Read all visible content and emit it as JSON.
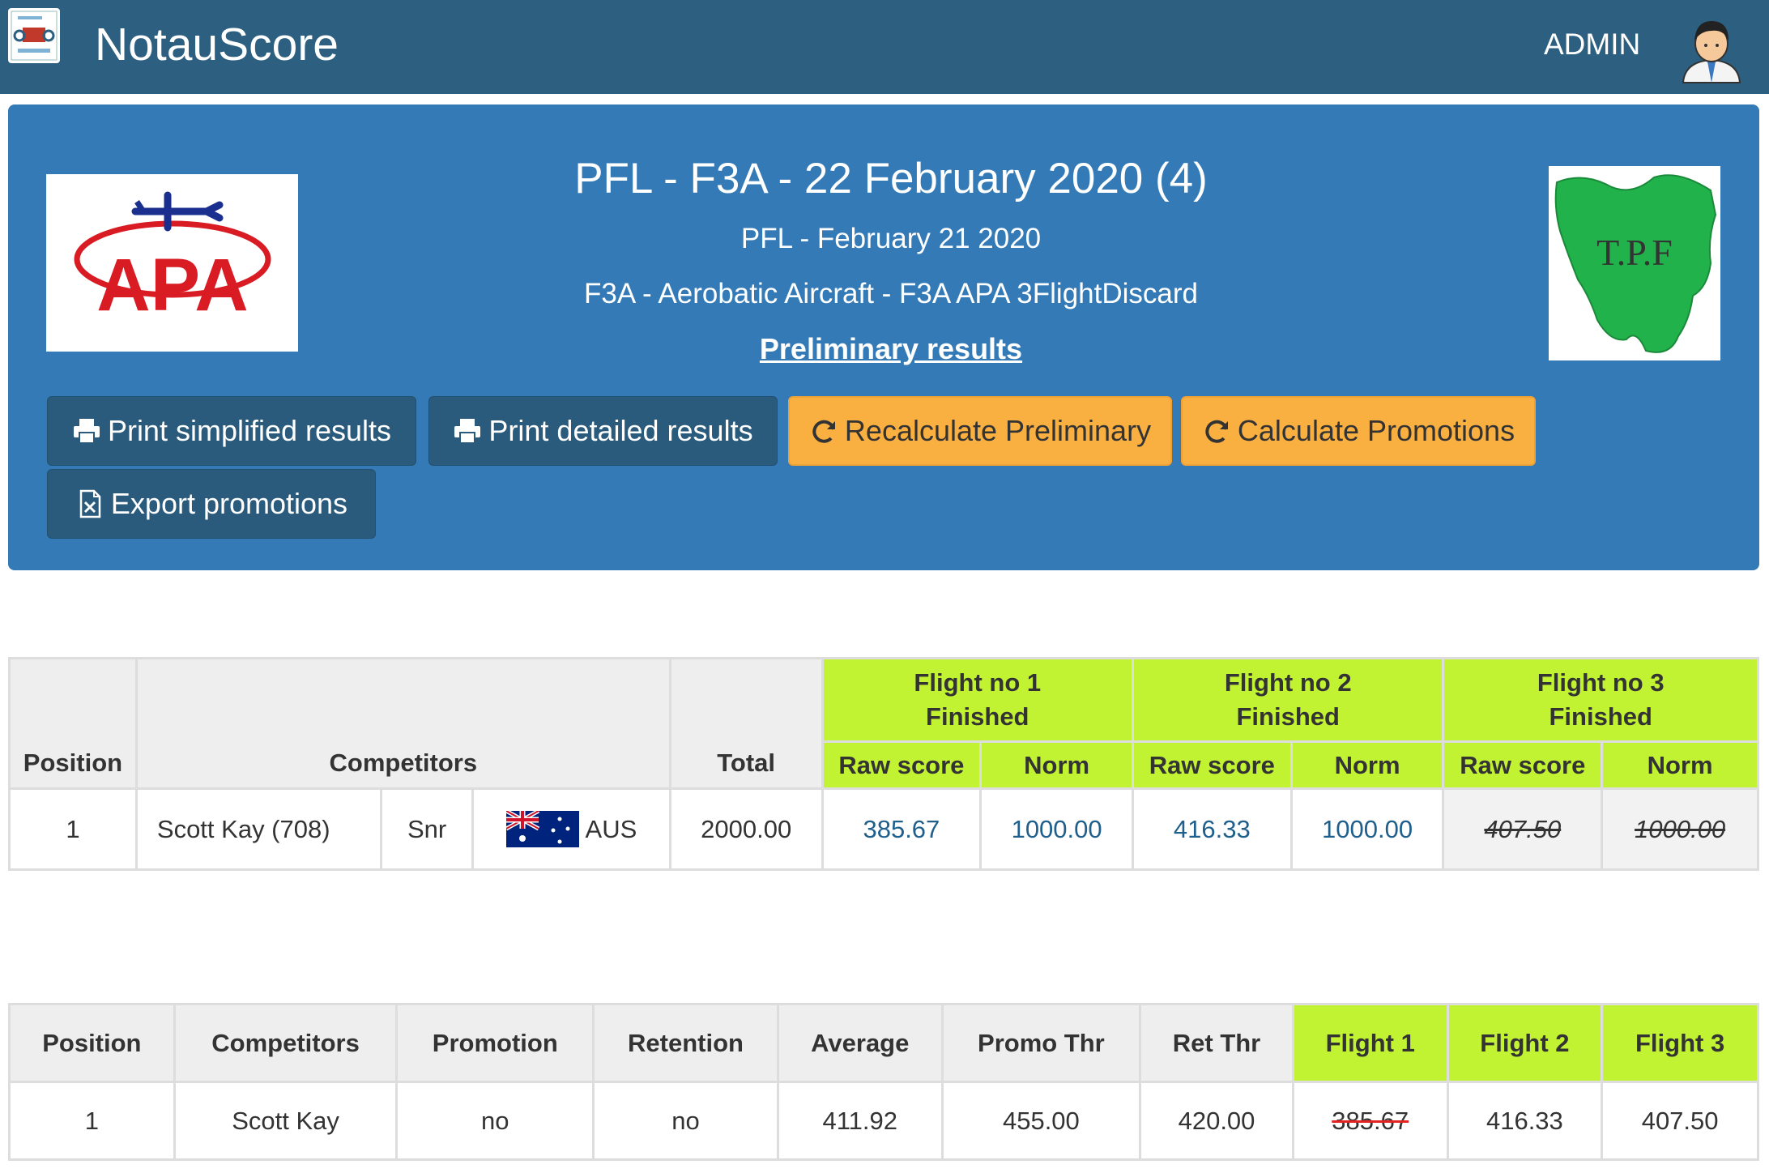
{
  "navbar": {
    "app_title": "NotauScore",
    "user_label": "ADMIN",
    "bg_color": "#2c5f80"
  },
  "header": {
    "event_title": "PFL - F3A - 22 February 2020 (4)",
    "event_subtitle": "PFL - February 21 2020",
    "event_class": "F3A - Aerobatic Aircraft - F3A APA 3FlightDiscard",
    "prelim_link": "Preliminary results",
    "left_logo_text": "APA",
    "right_logo_text": "T.P.F",
    "panel_color": "#337ab7"
  },
  "buttons": {
    "print_simplified": "Print simplified results",
    "print_detailed": "Print detailed results",
    "recalc_prelim": "Recalculate Preliminary",
    "calc_promotions": "Calculate Promotions",
    "export_promotions": "Export promotions"
  },
  "results_table": {
    "col_position": "Position",
    "col_competitors": "Competitors",
    "col_total": "Total",
    "flights": [
      {
        "title": "Flight no 1",
        "status": "Finished"
      },
      {
        "title": "Flight no 2",
        "status": "Finished"
      },
      {
        "title": "Flight no 3",
        "status": "Finished"
      }
    ],
    "sub_raw": "Raw score",
    "sub_norm": "Norm",
    "row": {
      "position": "1",
      "name": "Scott Kay (708)",
      "category": "Snr",
      "country": "AUS",
      "total": "2000.00",
      "f1_raw": "385.67",
      "f1_norm": "1000.00",
      "f2_raw": "416.33",
      "f2_norm": "1000.00",
      "f3_raw": "407.50",
      "f3_norm": "1000.00"
    }
  },
  "promo_table": {
    "headers": [
      "Position",
      "Competitors",
      "Promotion",
      "Retention",
      "Average",
      "Promo Thr",
      "Ret Thr",
      "Flight 1",
      "Flight 2",
      "Flight 3"
    ],
    "row": {
      "position": "1",
      "name": "Scott Kay",
      "promotion": "no",
      "retention": "no",
      "average": "411.92",
      "promo_thr": "455.00",
      "ret_thr": "420.00",
      "flight1": "385.67",
      "flight2": "416.33",
      "flight3": "407.50"
    }
  },
  "colors": {
    "flight_header": "#c2f332",
    "warn_button": "#f9b041",
    "dark_button": "#2a5a7c"
  }
}
